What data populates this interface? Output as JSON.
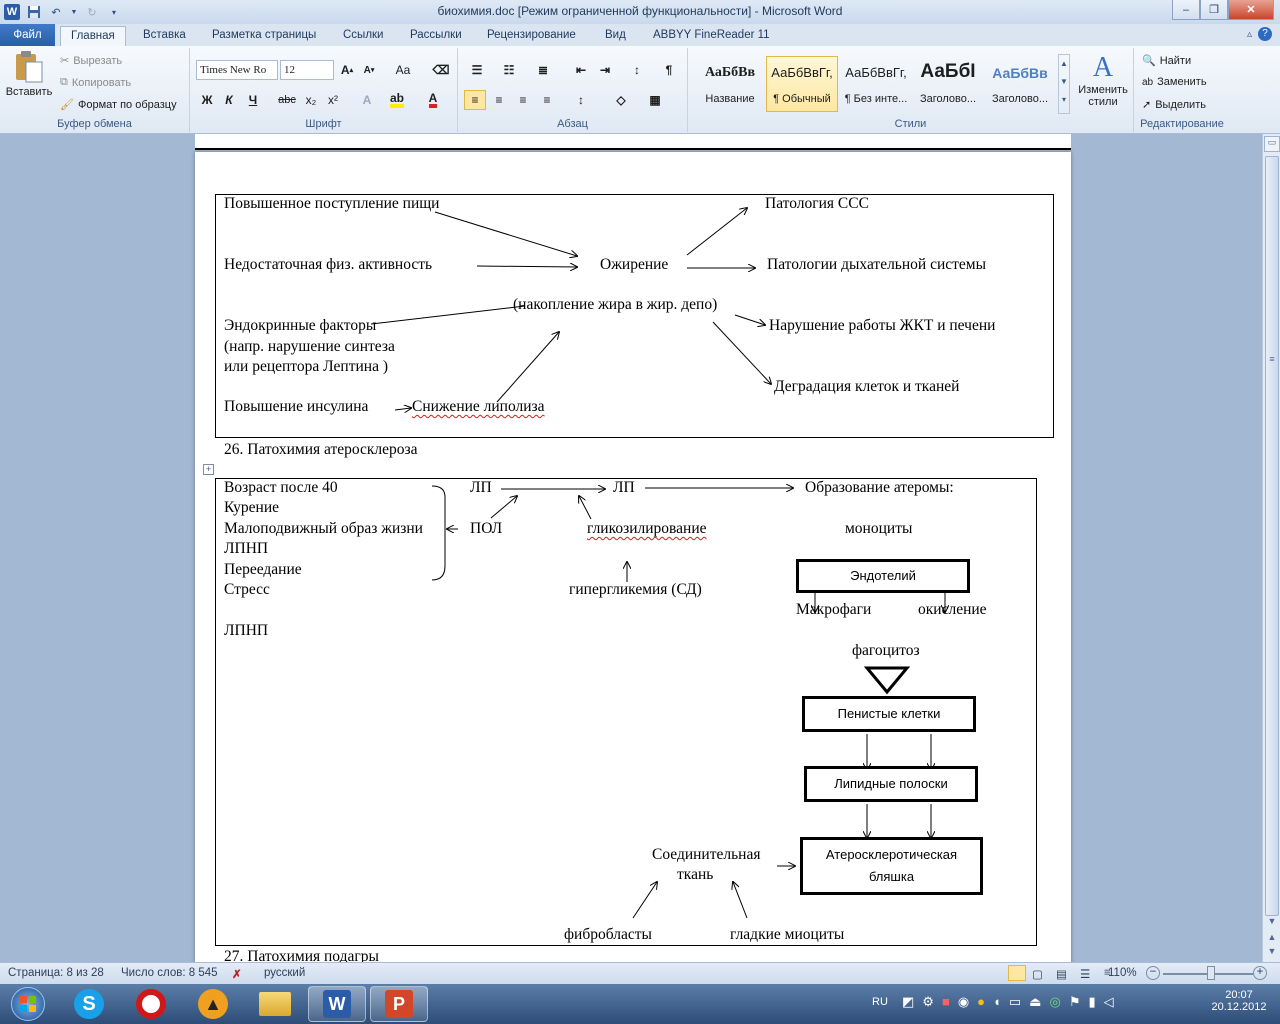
{
  "window": {
    "title": "биохимия.doc [Режим ограниченной функциональности]  -  Microsoft Word",
    "minimize": "‒",
    "restore": "❐",
    "close": "✕"
  },
  "tabs": [
    "Файл",
    "Главная",
    "Вставка",
    "Разметка страницы",
    "Ссылки",
    "Рассылки",
    "Рецензирование",
    "Вид",
    "ABBYY FineReader 11"
  ],
  "ribbon": {
    "clipboard": {
      "label": "Буфер обмена",
      "paste": "Вставить",
      "cut": "Вырезать",
      "copy": "Копировать",
      "format_painter": "Формат по образцу"
    },
    "font": {
      "label": "Шрифт",
      "font_name": "Times New Ro",
      "font_size": "12"
    },
    "paragraph": {
      "label": "Абзац"
    },
    "styles": {
      "label": "Стили",
      "cards": [
        {
          "sample": "АаБбВв",
          "name": "Название"
        },
        {
          "sample": "АаБбВвГг,",
          "name": "¶ Обычный"
        },
        {
          "sample": "АаБбВвГг,",
          "name": "¶ Без инте..."
        },
        {
          "sample": "АаБбІ",
          "name": "Заголово..."
        },
        {
          "sample": "АаБбВв",
          "name": "Заголово..."
        }
      ],
      "change_styles": "Изменить стили"
    },
    "editing": {
      "label": "Редактирование",
      "find": "Найти",
      "replace": "Заменить",
      "select": "Выделить"
    }
  },
  "document": {
    "obesity": {
      "cause_food": "Повышенное поступление пищи",
      "cause_activity": "Недостаточная физ. активность",
      "cause_endocrine_1": "Эндокринные факторы",
      "cause_endocrine_2": "(напр. нарушение синтеза",
      "cause_endocrine_3": "или рецептора Лептина )",
      "cause_insulin": "Повышение инсулина",
      "cause_lipolysis": "Снижение липолиза",
      "center": "Ожирение",
      "center_sub": "(накопление жира в жир. депо)",
      "effect_cvs": "Патология ССС",
      "effect_resp": "Патологии дыхательной системы",
      "effect_git": "Нарушение работы ЖКТ и печени",
      "effect_degr": "Деградация клеток и тканей"
    },
    "heading_26": "26. Патохимия атеросклероза",
    "athero": {
      "factors": [
        "Возраст после 40",
        "Курение",
        "Малоподвижный образ жизни",
        "ЛПНП",
        "Переедание",
        "Стресс"
      ],
      "ldl_bottom": "ЛПНП",
      "lp1": "ЛП",
      "lp2": "ЛП",
      "pol": "ПОЛ",
      "glyc": "гликозилирование",
      "hyperglyc": "гипергликемия (СД)",
      "atheroma": "Образование атеромы:",
      "monocytes": "моноциты",
      "endothelium": "Эндотелий",
      "macrophages": "Макрофаги",
      "oxidation": "окисление",
      "phagocytosis": "фагоцитоз",
      "foam_cells": "Пенистые клетки",
      "lipid_streaks": "Липидные полоски",
      "plaque_1": "Атеросклеротическая",
      "plaque_2": "бляшка",
      "connective_1": "Соединительная",
      "connective_2": "ткань",
      "fibroblasts": "фибробласты",
      "smooth_myocytes": "гладкие миоциты"
    },
    "heading_27": "27. Патохимия подагры"
  },
  "status": {
    "page": "Страница: 8 из 28",
    "words": "Число слов: 8 545",
    "language": "русский",
    "zoom": "110%"
  },
  "taskbar": {
    "lang": "RU",
    "time": "20:07",
    "date": "20.12.2012"
  }
}
